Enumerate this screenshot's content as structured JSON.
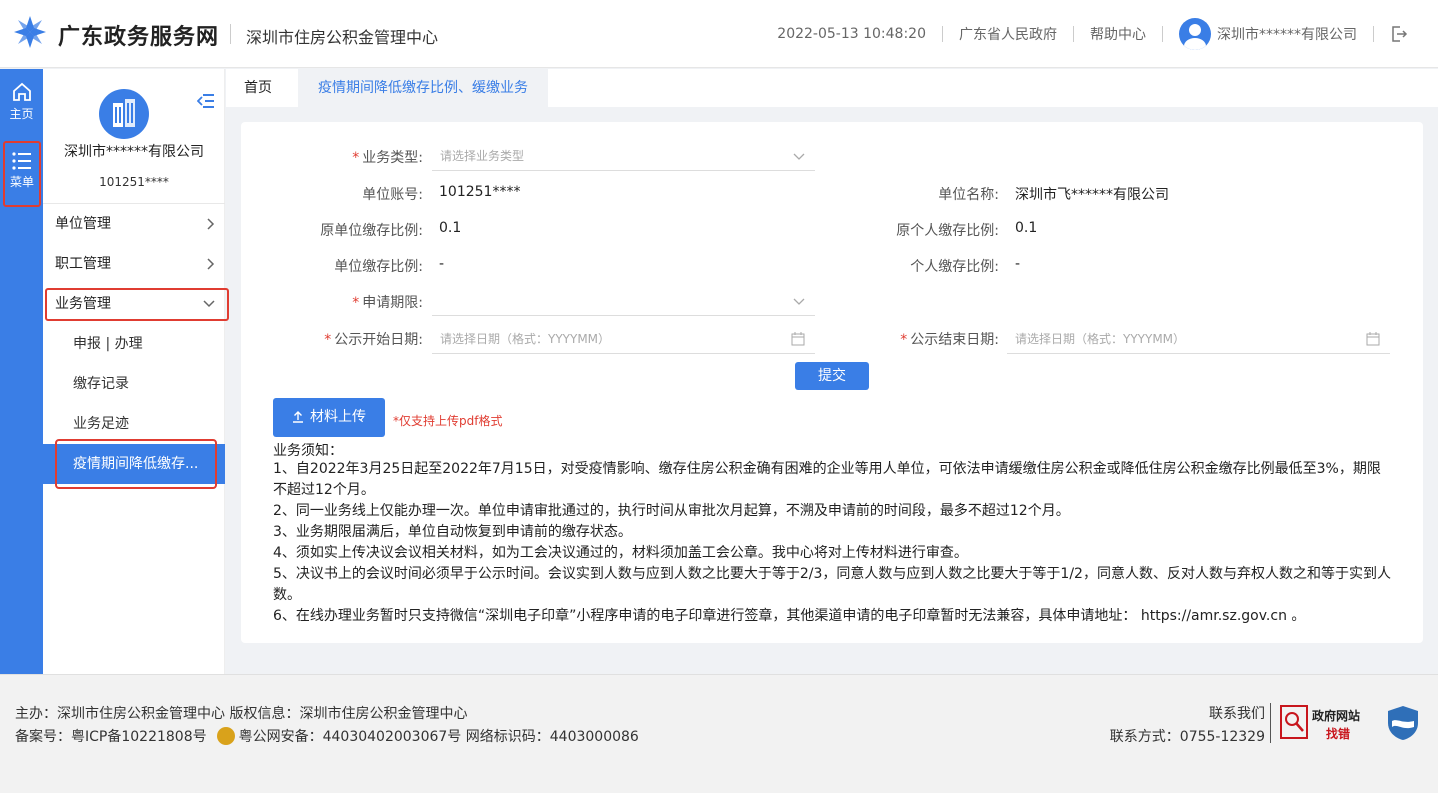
{
  "header": {
    "site_title": "广东政务服务网",
    "center_name": "深圳市住房公积金管理中心",
    "datetime": "2022-05-13 10:48:20",
    "gov_link": "广东省人民政府",
    "help_link": "帮助中心",
    "user_name": "深圳市******有限公司"
  },
  "rail": {
    "home_label": "主页",
    "menu_label": "菜单"
  },
  "sidebar": {
    "company_name": "深圳市******有限公司",
    "company_id": "101251****",
    "items": [
      {
        "label": "单位管理"
      },
      {
        "label": "职工管理"
      },
      {
        "label": "业务管理"
      }
    ],
    "sub_items": [
      {
        "label": "申报 | 办理"
      },
      {
        "label": "缴存记录"
      },
      {
        "label": "业务足迹"
      },
      {
        "label": "疫情期间降低缴存..."
      }
    ]
  },
  "tabs": {
    "home": "首页",
    "active": "疫情期间降低缴存比例、缓缴业务"
  },
  "form": {
    "business_type_label": "业务类型:",
    "business_type_placeholder": "请选择业务类型",
    "unit_account_label": "单位账号:",
    "unit_account_value": "101251****",
    "unit_name_label": "单位名称:",
    "unit_name_value": "深圳市飞******有限公司",
    "orig_unit_ratio_label": "原单位缴存比例:",
    "orig_unit_ratio_value": "0.1",
    "orig_personal_ratio_label": "原个人缴存比例:",
    "orig_personal_ratio_value": "0.1",
    "unit_ratio_label": "单位缴存比例:",
    "unit_ratio_value": "-",
    "personal_ratio_label": "个人缴存比例:",
    "personal_ratio_value": "-",
    "period_label": "申请期限:",
    "start_date_label": "公示开始日期:",
    "start_date_placeholder": "请选择日期（格式：YYYYMM）",
    "end_date_label": "公示结束日期:",
    "end_date_placeholder": "请选择日期（格式：YYYYMM）",
    "submit_label": "提交",
    "upload_label": "材料上传",
    "upload_hint": "*仅支持上传pdf格式"
  },
  "notice": {
    "title": "业务须知：",
    "items": [
      "1、自2022年3月25日起至2022年7月15日，对受疫情影响、缴存住房公积金确有困难的企业等用人单位，可依法申请缓缴住房公积金或降低住房公积金缴存比例最低至3%，期限不超过12个月。",
      "2、同一业务线上仅能办理一次。单位申请审批通过的，执行时间从审批次月起算，不溯及申请前的时间段，最多不超过12个月。",
      "3、业务期限届满后，单位自动恢复到申请前的缴存状态。",
      "4、须如实上传决议会议相关材料，如为工会决议通过的，材料须加盖工会公章。我中心将对上传材料进行审查。",
      "5、决议书上的会议时间必须早于公示时间。会议实到人数与应到人数之比要大于等于2/3，同意人数与应到人数之比要大于等于1/2，同意人数、反对人数与弃权人数之和等于实到人数。",
      "6、在线办理业务暂时只支持微信“深圳电子印章”小程序申请的电子印章进行签章，其他渠道申请的电子印章暂时无法兼容，具体申请地址： https://amr.sz.gov.cn 。"
    ]
  },
  "footer": {
    "line1": "主办：深圳市住房公积金管理中心  版权信息：深圳市住房公积金管理中心",
    "icp": "备案号：粤ICP备10221808号",
    "police": "粤公网安备：44030402003067号  网络标识码：4403000086",
    "contact_title": "联系我们",
    "contact_phone": "联系方式：0755-12329",
    "badge_line1": "政府网站",
    "badge_line2": "找错"
  },
  "colors": {
    "primary": "#3a7ee6",
    "highlight": "#e03c31"
  }
}
